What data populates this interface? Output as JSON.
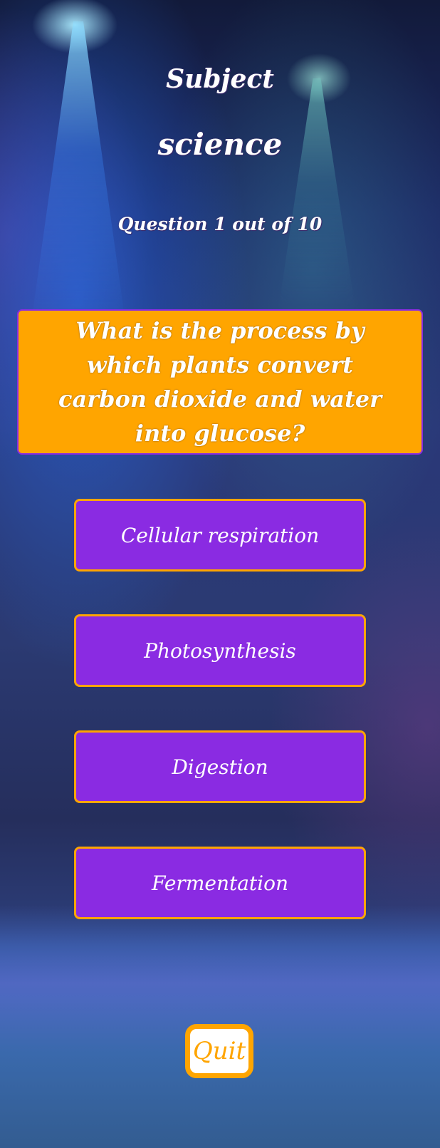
{
  "header": {
    "subject_heading": "Subject",
    "subject_name": "science",
    "progress": "Question 1 out of 10"
  },
  "question": {
    "text": "What is the process by which plants convert carbon dioxide and water into glucose?"
  },
  "answers": [
    {
      "label": "Cellular respiration"
    },
    {
      "label": "Photosynthesis"
    },
    {
      "label": "Digestion"
    },
    {
      "label": "Fermentation"
    }
  ],
  "footer": {
    "quit_label": "Quit"
  },
  "colors": {
    "question_background": "#ffa500",
    "answer_background": "#8a2be2",
    "answer_border": "#ffa500",
    "quit_text": "#ffa500"
  }
}
